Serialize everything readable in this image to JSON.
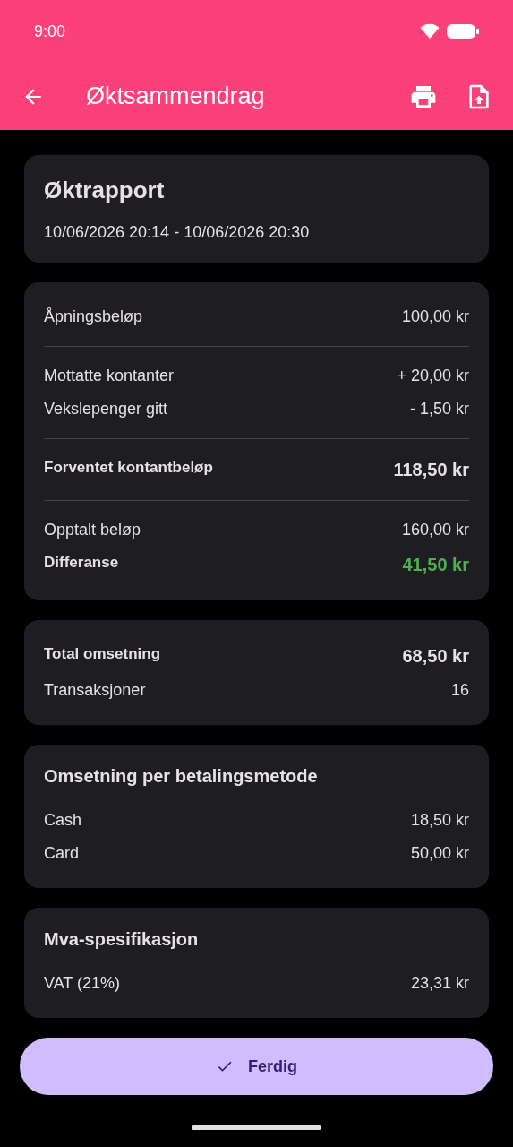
{
  "status_bar": {
    "time": "9:00"
  },
  "app_bar": {
    "title": "Øktsammendrag"
  },
  "cards": [
    {
      "kind": "header",
      "title": "Øktrapport",
      "subtitle": "10/06/2026 20:14 - 10/06/2026 20:30"
    },
    {
      "kind": "groups",
      "groups": [
        [
          {
            "label": "Åpningsbeløp",
            "value": "100,00 kr",
            "kind": "plain"
          }
        ],
        [
          {
            "label": "Mottatte kontanter",
            "value": "+ 20,00 kr",
            "kind": "plain"
          },
          {
            "label": "Vekslepenger gitt",
            "value": "- 1,50 kr",
            "kind": "plain"
          }
        ],
        [
          {
            "label": "Forventet kontantbeløp",
            "value": "118,50 kr",
            "kind": "total"
          }
        ],
        [
          {
            "label": "Opptalt beløp",
            "value": "160,00 kr",
            "kind": "plain"
          },
          {
            "label": "Differanse",
            "value": "41,50 kr",
            "kind": "result"
          }
        ]
      ]
    },
    {
      "kind": "rows",
      "rows": [
        {
          "label": "Total omsetning",
          "value": "68,50 kr",
          "kind": "total"
        },
        {
          "label": "Transaksjoner",
          "value": "16",
          "kind": "plain"
        }
      ]
    },
    {
      "kind": "titled",
      "title": "Omsetning per betalingsmetode",
      "rows": [
        {
          "label": "Cash",
          "value": "18,50 kr",
          "kind": "plain"
        },
        {
          "label": "Card",
          "value": "50,00 kr",
          "kind": "plain"
        }
      ]
    },
    {
      "kind": "titled",
      "title": "Mva-spesifikasjon",
      "rows": [
        {
          "label": "VAT (21%)",
          "value": "23,31 kr",
          "kind": "plain"
        }
      ]
    }
  ],
  "button": {
    "label": "Ferdig"
  }
}
